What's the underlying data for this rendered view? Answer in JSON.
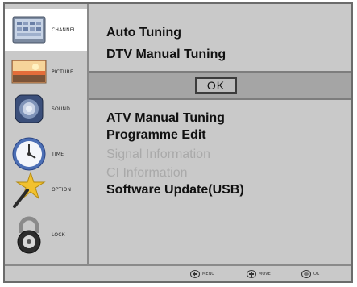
{
  "sidebar": {
    "items": [
      {
        "label": "CHANNEL",
        "icon": "channel-tv-icon"
      },
      {
        "label": "PICTURE",
        "icon": "picture-landscape-icon"
      },
      {
        "label": "SOUND",
        "icon": "speaker-icon"
      },
      {
        "label": "TIME",
        "icon": "clock-icon"
      },
      {
        "label": "OPTION",
        "icon": "magic-wand-icon"
      },
      {
        "label": "LOCK",
        "icon": "padlock-icon"
      }
    ],
    "selected": "CHANNEL"
  },
  "main": {
    "top_items": [
      "Auto Tuning",
      "DTV Manual Tuning"
    ],
    "ok_label": "OK",
    "items": [
      {
        "label": "ATV Manual Tuning",
        "enabled": true
      },
      {
        "label": "Programme Edit",
        "enabled": true
      },
      {
        "label": "Signal Information",
        "enabled": false
      },
      {
        "label": "CI Information",
        "enabled": false
      },
      {
        "label": "Software Update(USB)",
        "enabled": true
      }
    ]
  },
  "footer": {
    "menu_hint": "MENU",
    "move_hint": "MOVE",
    "ok_hint": "OK"
  },
  "colors": {
    "background": "#c9c9c9",
    "band": "#a5a5a5",
    "disabled_text": "#a9a9a9"
  }
}
